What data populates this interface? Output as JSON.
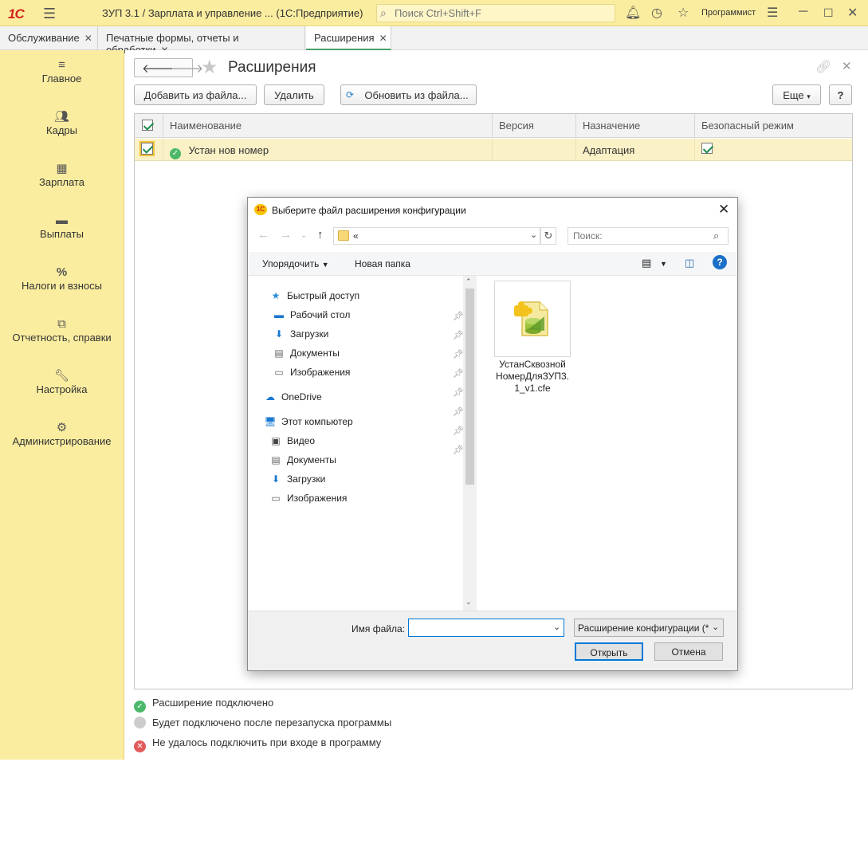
{
  "topbar": {
    "logo": "1С",
    "app_title": "ЗУП 3.1 / Зарплата и управление ...  (1С:Предприятие)",
    "search_placeholder": "Поиск Ctrl+Shift+F",
    "user": "Программист"
  },
  "tabs": [
    {
      "label": "Обслуживание"
    },
    {
      "label": "Печатные формы, отчеты и обработки"
    },
    {
      "label": "Расширения"
    }
  ],
  "sidebar": {
    "items": [
      {
        "label": "Главное",
        "icon": "menu-icon"
      },
      {
        "label": "Кадры",
        "icon": "people-icon"
      },
      {
        "label": "Зарплата",
        "icon": "calculator-icon"
      },
      {
        "label": "Выплаты",
        "icon": "wallet-icon"
      },
      {
        "label": "Налоги и взносы",
        "icon": "percent-icon"
      },
      {
        "label": "Отчетность, справки",
        "icon": "documents-icon"
      },
      {
        "label": "Настройка",
        "icon": "wrench-icon"
      },
      {
        "label": "Администрирование",
        "icon": "gear-icon"
      }
    ]
  },
  "main": {
    "title": "Расширения",
    "buttons": {
      "add_from_file": "Добавить из файла...",
      "delete": "Удалить",
      "update_from_file": "Обновить из файла...",
      "more": "Еще",
      "help": "?"
    },
    "table": {
      "columns": [
        "Наименование",
        "Версия",
        "Назначение",
        "Безопасный режим"
      ],
      "rows": [
        {
          "name": "Устан нов номер",
          "version": "",
          "purpose": "Адаптация",
          "safe_mode": true,
          "active": true
        }
      ]
    },
    "legend": [
      {
        "label": "Расширение подключено",
        "color": "#4cb86a"
      },
      {
        "label": "Будет подключено после перезапуска программы",
        "color": "#cccccc"
      },
      {
        "label": "Не удалось подключить при входе в программу",
        "color": "#e05a5a"
      }
    ]
  },
  "dialog": {
    "title": "Выберите файл расширения конфигурации",
    "path": "«",
    "search_placeholder": "Поиск:",
    "toolbar": {
      "organize": "Упорядочить",
      "new_folder": "Новая папка"
    },
    "nav": {
      "quick_access": "Быстрый доступ",
      "quick_items": [
        "Рабочий стол",
        "Загрузки",
        "Документы",
        "Изображения"
      ],
      "onedrive": "OneDrive",
      "this_pc": "Этот компьютер",
      "pc_items": [
        "Видео",
        "Документы",
        "Загрузки",
        "Изображения"
      ]
    },
    "file": {
      "name": "УстанСквозной НомерДляЗУП3.1_v1.cfe",
      "lines": [
        "УстанСквозной",
        "НомерДляЗУП3.",
        "1_v1.cfe"
      ]
    },
    "filename_label": "Имя файла:",
    "filename_value": "",
    "filter": "Расширение конфигурации (*",
    "open_button": "Открыть",
    "cancel_button": "Отмена"
  },
  "colors": {
    "accent_yellow": "#fbeda0",
    "row_highlight": "#fbf1c6",
    "active_green": "#4cb86a",
    "focus_blue": "#0078d7"
  }
}
